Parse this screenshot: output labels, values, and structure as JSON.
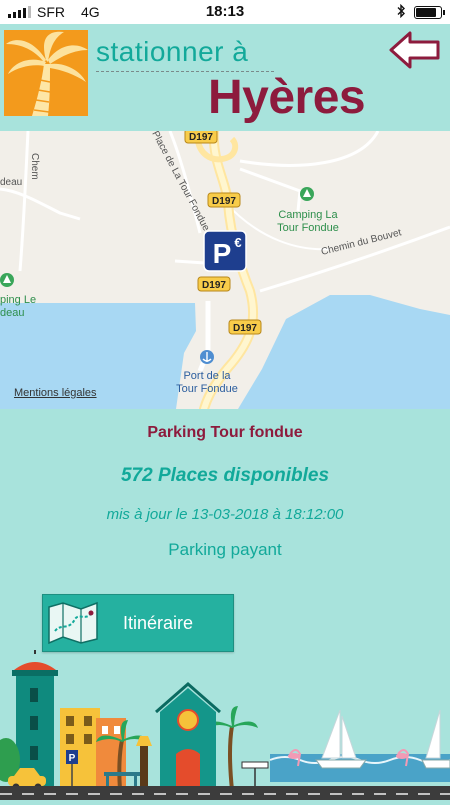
{
  "status_bar": {
    "carrier": "SFR",
    "network": "4G",
    "time": "18:13",
    "battery_level": 0.92
  },
  "header": {
    "brand_top": "stationner à",
    "brand_bottom": "Hyères",
    "back_icon": "arrow-left-icon"
  },
  "map": {
    "labels": {
      "road_d197": "D197",
      "campground": "Camping La Tour Fondue",
      "campground_line1": "Camping La",
      "campground_line2": "Tour Fondue",
      "campground_left_line1": "ping Le",
      "campground_left_line2": "deau",
      "street_left": "deau",
      "street_top": "Chem",
      "street_place": "Place de La Tour Fondue",
      "street_chemin": "Chemin du Bouvet",
      "port_line1": "Port de la",
      "port_line2": "Tour Fondue",
      "parking_marker": "P€"
    },
    "legal": "Mentions légales",
    "colors": {
      "water": "#a8d8f3",
      "land": "#f2efe9",
      "road_label": "#f8cc4a",
      "parking": "#1e3e8e",
      "green": "#3aa65a"
    }
  },
  "parking": {
    "name": "Parking Tour fondue",
    "places": "572 Places disponibles",
    "updated": "mis à jour le 13-03-2018 à 18:12:00",
    "type": "Parking payant"
  },
  "itinerary_button": {
    "label": "Itinéraire",
    "icon": "folded-map-icon"
  },
  "colors": {
    "background": "#a8e3dc",
    "accent_teal": "#12a99a",
    "accent_burgundy": "#8d1b3d",
    "logo_orange": "#f39a1c"
  }
}
